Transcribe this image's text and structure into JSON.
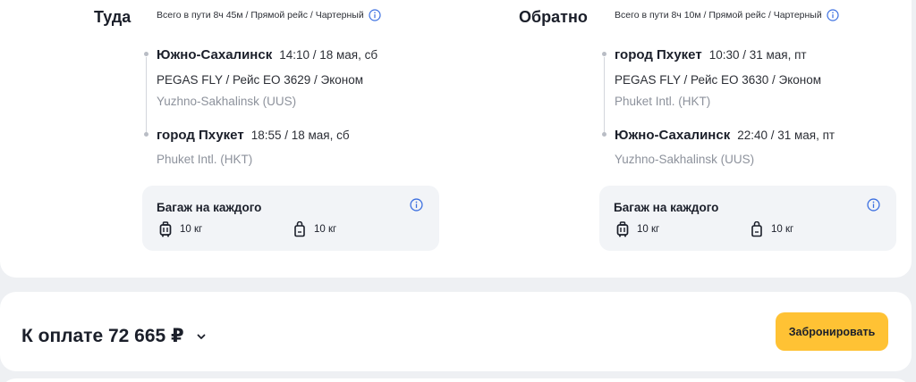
{
  "outbound": {
    "title": "Туда",
    "summary": "Всего в пути 8ч 45м / Прямой рейс / Чартерный",
    "departure": {
      "city": "Южно-Сахалинск",
      "time": "14:10 / 18 мая, сб"
    },
    "carrier": "PEGAS FLY / Рейс EO 3629 / Эконом",
    "departure_airport": "Yuzhno-Sakhalinsk (UUS)",
    "arrival": {
      "city": "город Пхукет",
      "time": "18:55 / 18 мая, сб"
    },
    "arrival_airport": "Phuket Intl. (HKT)",
    "baggage": {
      "title": "Багаж на каждого",
      "checked": "10 кг",
      "carry_on": "10 кг"
    }
  },
  "return": {
    "title": "Обратно",
    "summary": "Всего в пути 8ч 10м / Прямой рейс / Чартерный",
    "departure": {
      "city": "город Пхукет",
      "time": "10:30 / 31 мая, пт"
    },
    "carrier": "PEGAS FLY / Рейс EO 3630 / Эконом",
    "departure_airport": "Phuket Intl. (HKT)",
    "arrival": {
      "city": "Южно-Сахалинск",
      "time": "22:40 / 31 мая, пт"
    },
    "arrival_airport": "Yuzhno-Sakhalinsk (UUS)",
    "baggage": {
      "title": "Багаж на каждого",
      "checked": "10 кг",
      "carry_on": "10 кг"
    }
  },
  "payment": {
    "label": "К оплате 72 665 ₽",
    "book_button": "Забронировать"
  },
  "icons": {
    "info": "info-icon",
    "suitcase": "suitcase-icon",
    "bag": "bag-icon",
    "chevron": "chevron-down-icon"
  },
  "colors": {
    "accent_button": "#ffc234",
    "info_blue": "#3b6fe0",
    "muted_text": "#8d929c",
    "panel_bg": "#f2f4f7"
  }
}
